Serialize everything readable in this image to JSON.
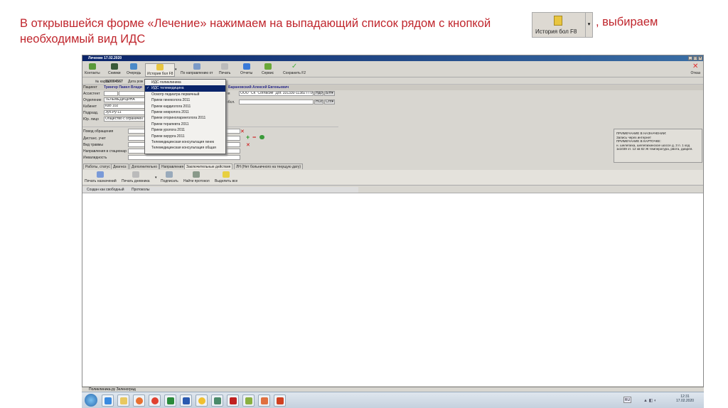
{
  "slide": {
    "text_before": "В открывшейся форме «Лечение» нажимаем на выпадающий список рядом с кнопкой",
    "text_after": ", выбираем",
    "text_line2": "необходимый вид ИДС",
    "button_sample_label": "История бол F8"
  },
  "window": {
    "title": "Лечение 17.02.2020",
    "min": "_",
    "max": "□",
    "close": "×"
  },
  "toolbar": [
    "Контакты",
    "Снимки",
    "Очередь",
    "История бол F8",
    "По направлению от",
    "Печать",
    "Отчеты",
    "Сервис",
    "Сохранить F2"
  ],
  "toolbar_cancel": "Отказ",
  "card": {
    "label": "№ карты",
    "value": "110004567",
    "date_label": "Дата рож"
  },
  "patient": {
    "label": "Пациент",
    "value": "Трингер Павел Влади",
    "doctor": "Барановский Алексей Евгеньевич"
  },
  "fields": [
    {
      "label": "Ассистент",
      "value": ""
    },
    {
      "label": "Отделение",
      "value": "ТЕЛЕМЕДИЦИНА"
    },
    {
      "label": "Кабинет",
      "value": "Каб 102"
    },
    {
      "label": "Подразд.",
      "value": "Зуб.Ру-11"
    },
    {
      "label": "Юр. лицо",
      "value": "Общество с ограничен"
    }
  ],
  "right_fields": {
    "contract_label": "ия",
    "contract_value": "ООО \"СК \"Согласие\" Дог. 331330-11382 ПТИ",
    "nds": "Ндс▾",
    "bn": "Б/Н▾",
    "obsl_label": "обсл.",
    "nds2": "НОс▾",
    "stp": "Стп▾"
  },
  "lower_fields": [
    "Повод обращения",
    "Дистанс. учет",
    "Вид травмы",
    "Направления в стационар",
    "Инвалидность"
  ],
  "menu": {
    "items": [
      "ИДС поликлиника",
      "ИДС телемедицина",
      "Осмотр педиатра первичный",
      "Прием гинеколога 2011",
      "Прием кардиолога 2011",
      "Прием невролога 2011",
      "Прием оториноларинголога 2011",
      "Прием терапевта 2011",
      "Прием уролога 2011",
      "Прием хирурга 2011",
      "Телемедицинская консультация гинек",
      "Телемедицинская консультация общая"
    ],
    "selected": 1,
    "check": "✓"
  },
  "note": [
    "ПРИМЕЧАНИЕ В НАЗНАЧЕНИИ:",
    "Запись через интернет",
    "ПРИМЕЧАНИЕ В КАРТОЧКЕ:",
    "н. шелепиха, шелепихинское шоссе д. 3 п. 1 код",
    "1к1039 эт. 12 кв 82 Ж температура, рвота, диарея."
  ],
  "tabs": [
    "Работы, статус",
    "Диагноз",
    "Дополнительно",
    "Направления",
    "Заключительные действия",
    "ЛН (Нет больничного на текущую дату)"
  ],
  "active_tab": 4,
  "sub_toolbar": [
    "Печать назначений",
    "Печать дневника",
    "Подписать",
    "Найти протокол",
    "Выделить все"
  ],
  "sub_tabs": [
    "Создан как свободный",
    "Протоколы"
  ],
  "status": "Поликлиника.ру Зеленоград",
  "tray": {
    "lang": "RU",
    "time": "12:31",
    "date": "17.02.2020"
  }
}
